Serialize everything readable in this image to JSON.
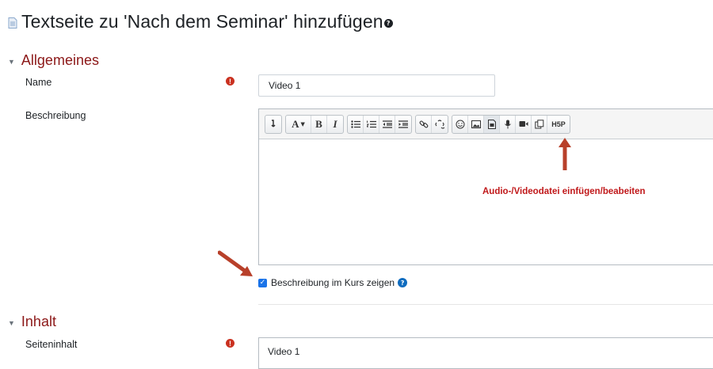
{
  "page": {
    "title": "Textseite zu 'Nach dem Seminar' hinzufügen",
    "title_icon": "document-icon",
    "help_icon": "help-icon"
  },
  "sections": {
    "general": {
      "label": "Allgemeines",
      "state": "expanded"
    },
    "content": {
      "label": "Inhalt",
      "state": "expanded"
    }
  },
  "fields": {
    "name": {
      "label": "Name",
      "value": "Video 1",
      "required": true
    },
    "description": {
      "label": "Beschreibung",
      "value": ""
    },
    "show_description": {
      "label": "Beschreibung im Kurs zeigen",
      "checked": true
    },
    "page_content": {
      "label": "Seiteninhalt",
      "value": "Video 1",
      "required": true
    }
  },
  "toolbar": {
    "groups": [
      [
        "toolbar-toggle-icon"
      ],
      [
        "font-style-icon",
        "bold-icon",
        "italic-icon"
      ],
      [
        "unordered-list-icon",
        "ordered-list-icon",
        "outdent-icon",
        "indent-icon"
      ],
      [
        "link-icon",
        "unlink-icon"
      ],
      [
        "emoticon-icon",
        "image-icon",
        "media-icon",
        "record-audio-icon",
        "record-video-icon",
        "manage-files-icon",
        "h5p-icon"
      ]
    ],
    "font_button_label": "A",
    "bold_label": "B",
    "italic_label": "I",
    "h5p_label": "H5P"
  },
  "annotation": {
    "text": "Audio-/Videodatei einfügen/beabeiten",
    "color": "#c0181a"
  },
  "colors": {
    "section_title": "#8c1818",
    "required": "#ca3120",
    "checkbox": "#1a73e8",
    "arrow": "#b8402a"
  }
}
